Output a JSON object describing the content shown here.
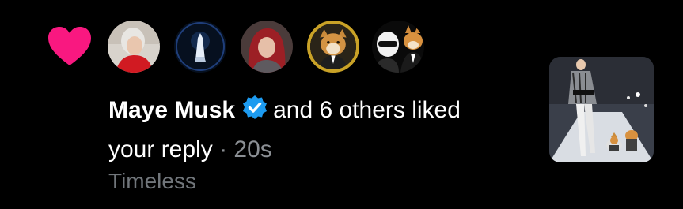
{
  "notification": {
    "icon": "heart-icon",
    "icon_color": "#f91880",
    "avatars": [
      {
        "icon": "avatar-photo"
      },
      {
        "icon": "avatar-photo"
      },
      {
        "icon": "avatar-photo"
      },
      {
        "icon": "avatar-photo"
      },
      {
        "icon": "avatar-photo"
      }
    ],
    "actor_name": "Maye Musk",
    "verified_badge": "verified-badge-icon",
    "badge_color": "#1d9bf0",
    "action_text": "and 6 others liked",
    "object_text": "your reply",
    "separator": "·",
    "timestamp": "20s",
    "snippet": "Timeless",
    "thumbnail": "post-thumbnail-image"
  }
}
